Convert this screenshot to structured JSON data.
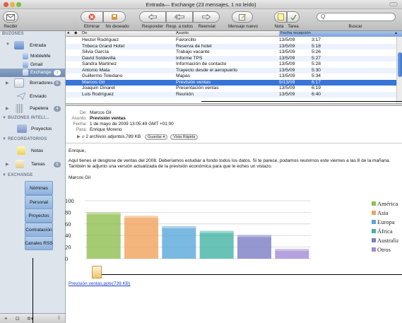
{
  "window": {
    "title": "Entrada— Exchange (23 mensajes, 1 no leído)"
  },
  "toolbar": {
    "get_mail": "Recibir",
    "delete": "Eliminar",
    "junk": "No deseado",
    "reply": "Responder",
    "reply_all": "Resp. a todos",
    "forward": "Reenviar",
    "new_message": "Mensaje nuevo",
    "note": "Nota",
    "todo": "Tarea",
    "search_label": "Buscar",
    "search_placeholder": "Q"
  },
  "sidebar": {
    "mailboxes_header": "BUZONES",
    "items": [
      {
        "label": "Entrada",
        "icon": "inbox-icon"
      },
      {
        "label": "MobileMe",
        "icon": "mobileme-icon"
      },
      {
        "label": "Gmail",
        "icon": "gmail-icon"
      },
      {
        "label": "Exchange",
        "icon": "exchange-icon",
        "badge": "1",
        "selected": true
      },
      {
        "label": "Borradores",
        "icon": "drafts-icon",
        "badge": "6"
      },
      {
        "label": "Enviado",
        "icon": "sent-icon"
      },
      {
        "label": "Papelera",
        "icon": "trash-icon",
        "badge": "4"
      }
    ],
    "smart_header": "BUZONES INTELI...",
    "smart_items": [
      {
        "label": "Proyectos"
      }
    ],
    "reminders_header": "RECORDATORIOS",
    "reminder_items": [
      {
        "label": "Notas"
      },
      {
        "label": "Tareas",
        "badge": "6"
      }
    ],
    "exchange_header": "EXCHANGE",
    "exchange_folders": [
      {
        "label": "Nóminas"
      },
      {
        "label": "Personal"
      },
      {
        "label": "Proyectos"
      },
      {
        "label": "Contratación"
      },
      {
        "label": "Canales RSS"
      }
    ],
    "bottom": {
      "add": "+",
      "show": "⊡",
      "action": "✲▾",
      "resize": "⦀"
    }
  },
  "message_list": {
    "columns": {
      "from": "De",
      "subject": "Asunto",
      "date": "Fecha recepción"
    },
    "rows": [
      {
        "from": "Hector Rodriguez",
        "subject": "Favorcillo",
        "date": "13/5/09",
        "time": "3:17"
      },
      {
        "from": "Tribeca Grand Hotel",
        "subject": "Reserva de hotel",
        "date": "13/5/09",
        "time": "5:18"
      },
      {
        "from": "Silvia García",
        "subject": "Trabajo vacante",
        "date": "13/5/09",
        "time": "5:26"
      },
      {
        "from": "David Soldevilla",
        "subject": "Informe TPS",
        "date": "13/5/09",
        "time": "5:27"
      },
      {
        "from": "Sandra Martinez",
        "subject": "Información de contacto",
        "date": "13/5/09",
        "time": "5:28"
      },
      {
        "from": "Antonio Mata",
        "subject": "Trayecto desde el aeropuerto",
        "date": "13/5/09",
        "time": "5:30"
      },
      {
        "from": "Guillermo Toledano",
        "subject": "Mapas",
        "date": "13/5/09",
        "time": "5:34"
      },
      {
        "from": "Marcos Gil",
        "subject": "Previsión ventas",
        "date": "5/13/09",
        "time": "6:17",
        "selected": true
      },
      {
        "from": "Joaquin Dinaret",
        "subject": "Presentación ventas",
        "date": "13/5/09",
        "time": "6:19"
      },
      {
        "from": "Luis Rodríguez",
        "subject": "Reunión",
        "date": "13/5/09",
        "time": "6:40"
      }
    ]
  },
  "message": {
    "from_key": "De:",
    "from": "Marcos Gil",
    "subject_key": "Asunto:",
    "subject": "Previsión ventas",
    "date_key": "Fecha:",
    "date": "1 de mayo de 2009 13:05:49 GMT +01:00",
    "to_key": "Para:",
    "to": "Enrique Moreno",
    "attachments": "2 archivos adjuntos,789 KB",
    "save_button": "Guardar ▾",
    "quicklook_button": "Vista Rápida",
    "greeting": "Enrique,",
    "body": "Aquí tienes el desglose de ventas del 2008. Deberíamos estudiar a fondo todos los datos. Si te parece, podamos reunirnos este viernes a las 8 de la mañana. También te adjunto una versión actualizada de la previsión económica para que le eches un vistazo.",
    "signature": "Marcos Gil",
    "attachment_link": "Previsión ventas.pptx(739 KB)"
  },
  "chart_data": {
    "type": "bar",
    "categories": [
      "América",
      "Asia",
      "Europa",
      "África",
      "Australia",
      "Otros"
    ],
    "values": [
      80,
      74,
      56,
      48,
      41,
      17
    ],
    "colors": [
      "#8fbf4f",
      "#f0a35a",
      "#59a7d9",
      "#43b3a4",
      "#7b7dc4",
      "#a08bd6"
    ],
    "ylim": [
      0,
      100
    ],
    "yticks": [
      "100",
      "80",
      "60",
      "40",
      "20",
      "0"
    ],
    "legend_position": "right",
    "grid": true
  }
}
